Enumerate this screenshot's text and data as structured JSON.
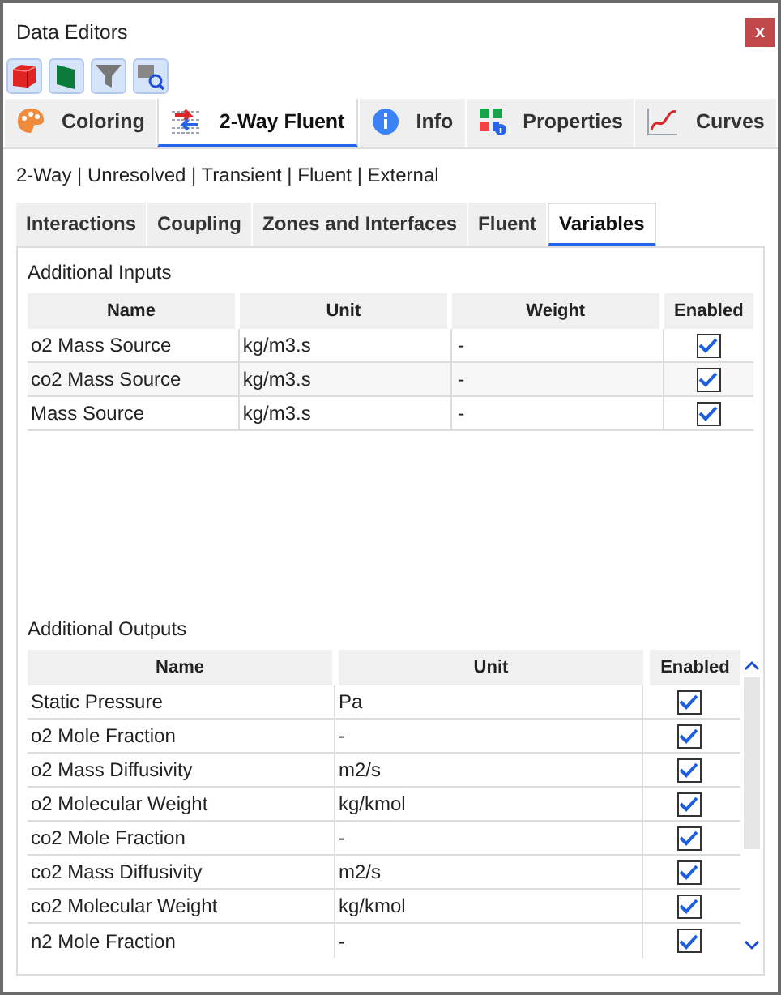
{
  "window": {
    "title": "Data Editors",
    "close": "x"
  },
  "toolbar": [
    {
      "kind": "cube"
    },
    {
      "kind": "plane"
    },
    {
      "kind": "filter"
    },
    {
      "kind": "inspect"
    }
  ],
  "tabs": [
    {
      "label": "Coloring",
      "kind": "palette",
      "selected": false
    },
    {
      "label": "2-Way Fluent",
      "kind": "exchange",
      "selected": true
    },
    {
      "label": "Info",
      "kind": "info",
      "selected": false
    },
    {
      "label": "Properties",
      "kind": "grid",
      "selected": false
    },
    {
      "label": "Curves",
      "kind": "curve",
      "selected": false
    }
  ],
  "summary": "2-Way | Unresolved | Transient | Fluent | External",
  "subtabs": [
    {
      "label": "Interactions",
      "selected": false
    },
    {
      "label": "Coupling",
      "selected": false
    },
    {
      "label": "Zones and Interfaces",
      "selected": false
    },
    {
      "label": "Fluent",
      "selected": false
    },
    {
      "label": "Variables",
      "selected": true
    }
  ],
  "inputs": {
    "title": "Additional Inputs",
    "columns": [
      "Name",
      "Unit",
      "Weight",
      "Enabled"
    ],
    "rows": [
      {
        "name": "o2 Mass Source",
        "unit": "kg/m3.s",
        "weight": "-",
        "enabled": true
      },
      {
        "name": "co2 Mass Source",
        "unit": "kg/m3.s",
        "weight": "-",
        "enabled": true
      },
      {
        "name": "Mass Source",
        "unit": "kg/m3.s",
        "weight": "-",
        "enabled": true
      }
    ]
  },
  "outputs": {
    "title": "Additional Outputs",
    "columns": [
      "Name",
      "Unit",
      "Enabled"
    ],
    "rows": [
      {
        "name": "Static Pressure",
        "unit": "Pa",
        "enabled": true
      },
      {
        "name": "o2 Mole Fraction",
        "unit": "-",
        "enabled": true
      },
      {
        "name": "o2 Mass Diffusivity",
        "unit": "m2/s",
        "enabled": true
      },
      {
        "name": "o2 Molecular Weight",
        "unit": "kg/kmol",
        "enabled": true
      },
      {
        "name": "co2 Mole Fraction",
        "unit": "-",
        "enabled": true
      },
      {
        "name": "co2 Mass Diffusivity",
        "unit": "m2/s",
        "enabled": true
      },
      {
        "name": "co2 Molecular Weight",
        "unit": "kg/kmol",
        "enabled": true
      },
      {
        "name": "n2 Mole Fraction",
        "unit": "-",
        "enabled": true
      }
    ]
  }
}
